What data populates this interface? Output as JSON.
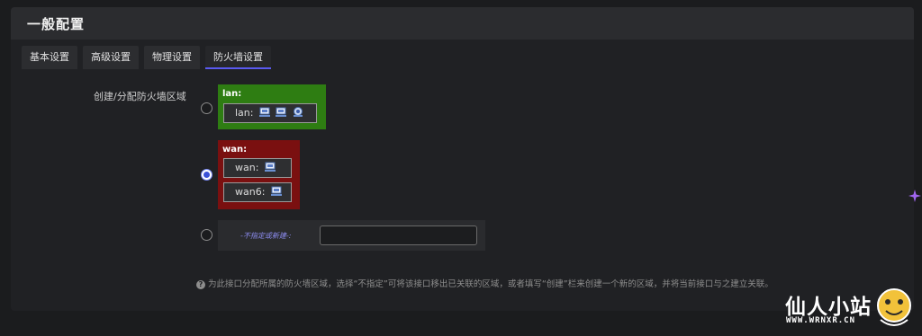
{
  "panel": {
    "title": "一般配置"
  },
  "tabs": [
    {
      "label": "基本设置",
      "active": false
    },
    {
      "label": "高级设置",
      "active": false
    },
    {
      "label": "物理设置",
      "active": false
    },
    {
      "label": "防火墙设置",
      "active": true
    }
  ],
  "firewall": {
    "field_label": "创建/分配防火墙区域",
    "zones": [
      {
        "name": "lan:",
        "color": "#2e7d12",
        "checked": false,
        "interfaces": [
          "lan:"
        ],
        "interface_icons": [
          "network-port-icon",
          "network-port-icon",
          "wireless-icon"
        ]
      },
      {
        "name": "wan:",
        "color": "#7a1010",
        "checked": true,
        "interfaces": [
          "wan:",
          "wan6:"
        ],
        "interface_icons": [
          "network-port-icon"
        ]
      }
    ],
    "new_zone": {
      "label": "-不指定或新建-:",
      "value": "",
      "checked": false
    },
    "help_text": "为此接口分配所属的防火墙区域，选择“不指定”可将该接口移出已关联的区域，或者填写“创建”栏来创建一个新的区域，并将当前接口与之建立关联。"
  },
  "watermark": {
    "title": "仙人小站",
    "url": "WWW.WRNXR.CN"
  },
  "colors": {
    "accent": "#3a50d8",
    "background": "#1b1c1e",
    "panel": "#202124"
  }
}
